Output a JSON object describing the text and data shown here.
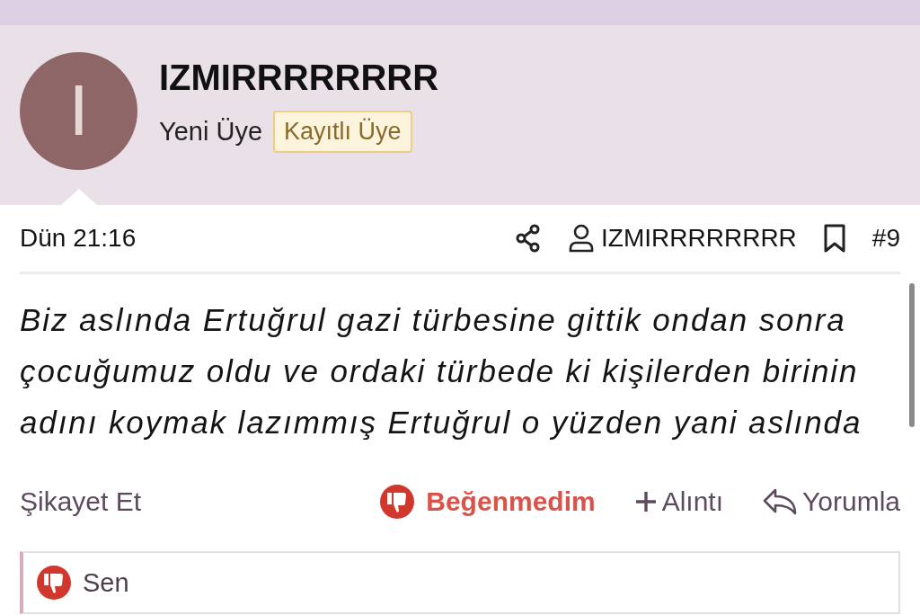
{
  "author": {
    "avatar_letter": "I",
    "name": "IZMIRRRRRRRR",
    "title": "Yeni Üye",
    "badge": "Kayıtlı Üye"
  },
  "post": {
    "date": "Dün 21:16",
    "author": "IZMIRRRRRRRR",
    "number": "#9",
    "body": "Biz aslında Ertuğrul gazi türbesine gittik ondan sonra çocuğumuz oldu ve ordaki türbede ki kişilerden birinin adını koymak lazımmış Ertuğrul o yüzden yani aslında"
  },
  "actions": [
    {
      "kind": "report",
      "label": "Şikayet Et"
    },
    {
      "kind": "reaction",
      "label": "Beğenmedim",
      "selected": true
    },
    {
      "kind": "quote",
      "label": "Alıntı"
    },
    {
      "kind": "reply",
      "label": "Yorumla"
    }
  ],
  "reactions_bar": {
    "user": "Sen"
  }
}
